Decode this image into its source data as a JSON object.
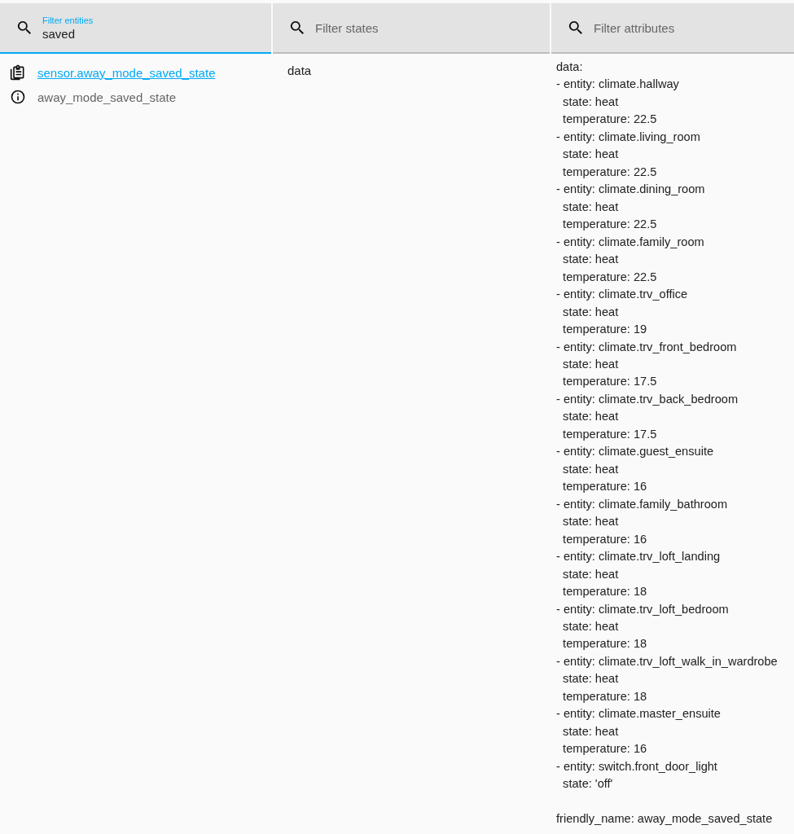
{
  "filters": [
    {
      "label": "Filter entities",
      "value": "saved",
      "focused": true
    },
    {
      "placeholder": "Filter states",
      "focused": false
    },
    {
      "placeholder": "Filter attributes",
      "focused": false
    }
  ],
  "entities": [
    {
      "entity_id": "sensor.away_mode_saved_state",
      "friendly_name": "away_mode_saved_state",
      "state": "data",
      "attributes": [
        "data:",
        "- entity: climate.hallway",
        "  state: heat",
        "  temperature: 22.5",
        "- entity: climate.living_room",
        "  state: heat",
        "  temperature: 22.5",
        "- entity: climate.dining_room",
        "  state: heat",
        "  temperature: 22.5",
        "- entity: climate.family_room",
        "  state: heat",
        "  temperature: 22.5",
        "- entity: climate.trv_office",
        "  state: heat",
        "  temperature: 19",
        "- entity: climate.trv_front_bedroom",
        "  state: heat",
        "  temperature: 17.5",
        "- entity: climate.trv_back_bedroom",
        "  state: heat",
        "  temperature: 17.5",
        "- entity: climate.guest_ensuite",
        "  state: heat",
        "  temperature: 16",
        "- entity: climate.family_bathroom",
        "  state: heat",
        "  temperature: 16",
        "- entity: climate.trv_loft_landing",
        "  state: heat",
        "  temperature: 18",
        "- entity: climate.trv_loft_bedroom",
        "  state: heat",
        "  temperature: 18",
        "- entity: climate.trv_loft_walk_in_wardrobe",
        "  state: heat",
        "  temperature: 18",
        "- entity: climate.master_ensuite",
        "  state: heat",
        "  temperature: 16",
        "- entity: switch.front_door_light",
        "  state: 'off'"
      ],
      "footer": "friendly_name: away_mode_saved_state"
    }
  ]
}
